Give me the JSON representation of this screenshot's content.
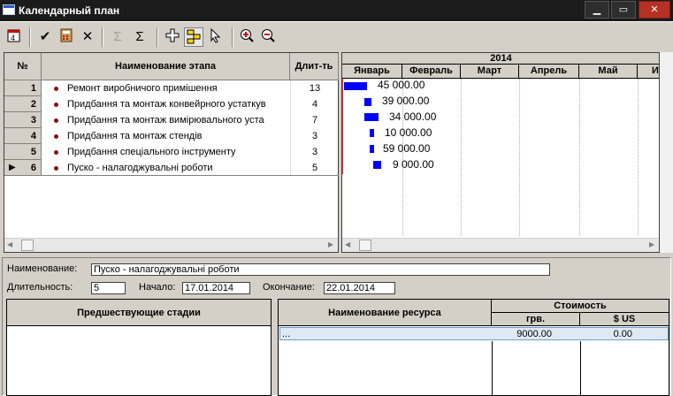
{
  "window": {
    "title": "Календарный план"
  },
  "stages_table": {
    "headers": {
      "num": "№",
      "name": "Наименование этапа",
      "duration": "Длит-ть"
    },
    "rows": [
      {
        "num": "1",
        "name": "Ремонт виробничого примішення",
        "duration": "13"
      },
      {
        "num": "2",
        "name": "Придбання та монтаж конвейрного устаткув",
        "duration": "4"
      },
      {
        "num": "3",
        "name": "Придбання та монтаж вимірювального уста",
        "duration": "7"
      },
      {
        "num": "4",
        "name": "Придбання та монтаж стендів",
        "duration": "3"
      },
      {
        "num": "5",
        "name": "Придбання спеціального інструменту",
        "duration": "3"
      },
      {
        "num": "6",
        "name": "Пуско - налагоджувальні роботи",
        "duration": "5"
      }
    ],
    "current_row_marker": "▶"
  },
  "gantt": {
    "year": "2014",
    "months": [
      "Январь",
      "Февраль",
      "Март",
      "Апрель",
      "Май",
      "И"
    ],
    "bar_color": "#0000ff",
    "amounts": [
      "45 000.00",
      "39 000.00",
      "34 000.00",
      "10 000.00",
      "59 000.00",
      "9 000.00"
    ]
  },
  "details": {
    "name_label": "Наименование:",
    "name_value": "Пуско - налагоджувальні роботи",
    "duration_label": "Длительность:",
    "duration_value": "5",
    "start_label": "Начало:",
    "start_value": "17.01.2014",
    "end_label": "Окончание:",
    "end_value": "22.01.2014"
  },
  "predecessors": {
    "header": "Предшествующие стадии"
  },
  "resources": {
    "header_name": "Наименование ресурса",
    "header_cost": "Стоимость",
    "header_uah": "грв.",
    "header_usd": "$ US",
    "rows": [
      {
        "name": "...",
        "uah": "9000.00",
        "usd": "0.00"
      }
    ]
  }
}
